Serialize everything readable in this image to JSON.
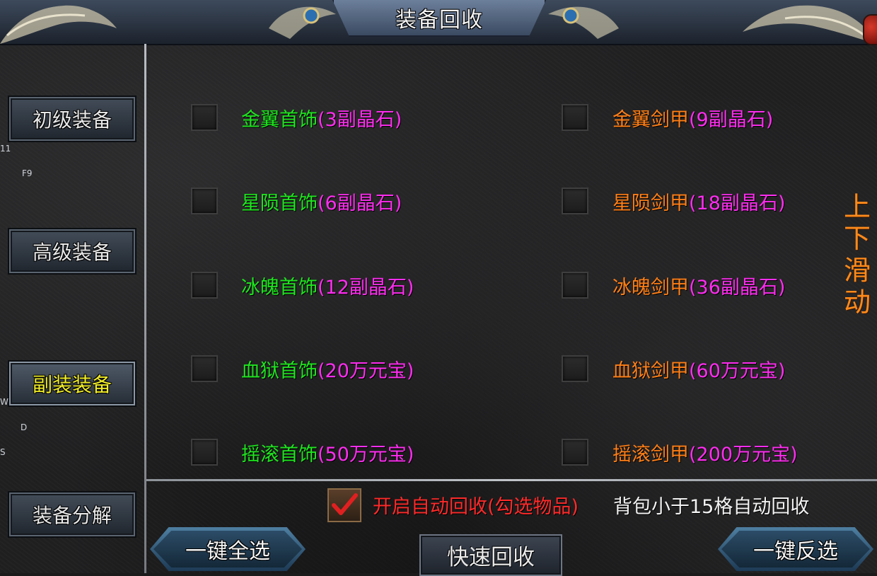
{
  "window": {
    "title": "装备回收"
  },
  "sidebar": {
    "items": [
      {
        "label": "初级装备",
        "active": false
      },
      {
        "label": "高级装备",
        "active": false
      },
      {
        "label": "副装装备",
        "active": true
      },
      {
        "label": "装备分解",
        "active": false
      }
    ],
    "stray_labels": [
      "11",
      "F9",
      "W",
      "D",
      "S"
    ]
  },
  "items": [
    {
      "name": "金翼首饰",
      "cost": "(3副晶石)",
      "checked": false
    },
    {
      "name": "金翼剑甲",
      "cost": "(9副晶石)",
      "checked": false
    },
    {
      "name": "星陨首饰",
      "cost": "(6副晶石)",
      "checked": false
    },
    {
      "name": "星陨剑甲",
      "cost": "(18副晶石)",
      "checked": false
    },
    {
      "name": "冰魄首饰",
      "cost": "(12副晶石)",
      "checked": false
    },
    {
      "name": "冰魄剑甲",
      "cost": "(36副晶石)",
      "checked": false
    },
    {
      "name": "血狱首饰",
      "cost": "(20万元宝)",
      "checked": false
    },
    {
      "name": "血狱剑甲",
      "cost": "(60万元宝)",
      "checked": false
    },
    {
      "name": "摇滚首饰",
      "cost": "(50万元宝)",
      "checked": false
    },
    {
      "name": "摇滚剑甲",
      "cost": "(200万元宝)",
      "checked": false
    }
  ],
  "scroll_hint": [
    "上",
    "下",
    "滑",
    "动"
  ],
  "auto_recycle": {
    "checked": true,
    "label": "开启自动回收(勾选物品)",
    "bag_label": "背包小于15格自动回收"
  },
  "buttons": {
    "select_all": "一键全选",
    "quick_recycle": "快速回收",
    "invert_select": "一键反选"
  },
  "colors": {
    "accessory_name": "#1fe51f",
    "armor_name": "#ff7f17",
    "cost": "#ff2df0",
    "auto_label": "#ff2a2a",
    "active_tab": "#f1ee2a",
    "scroll_hint": "#ff8a1a"
  }
}
